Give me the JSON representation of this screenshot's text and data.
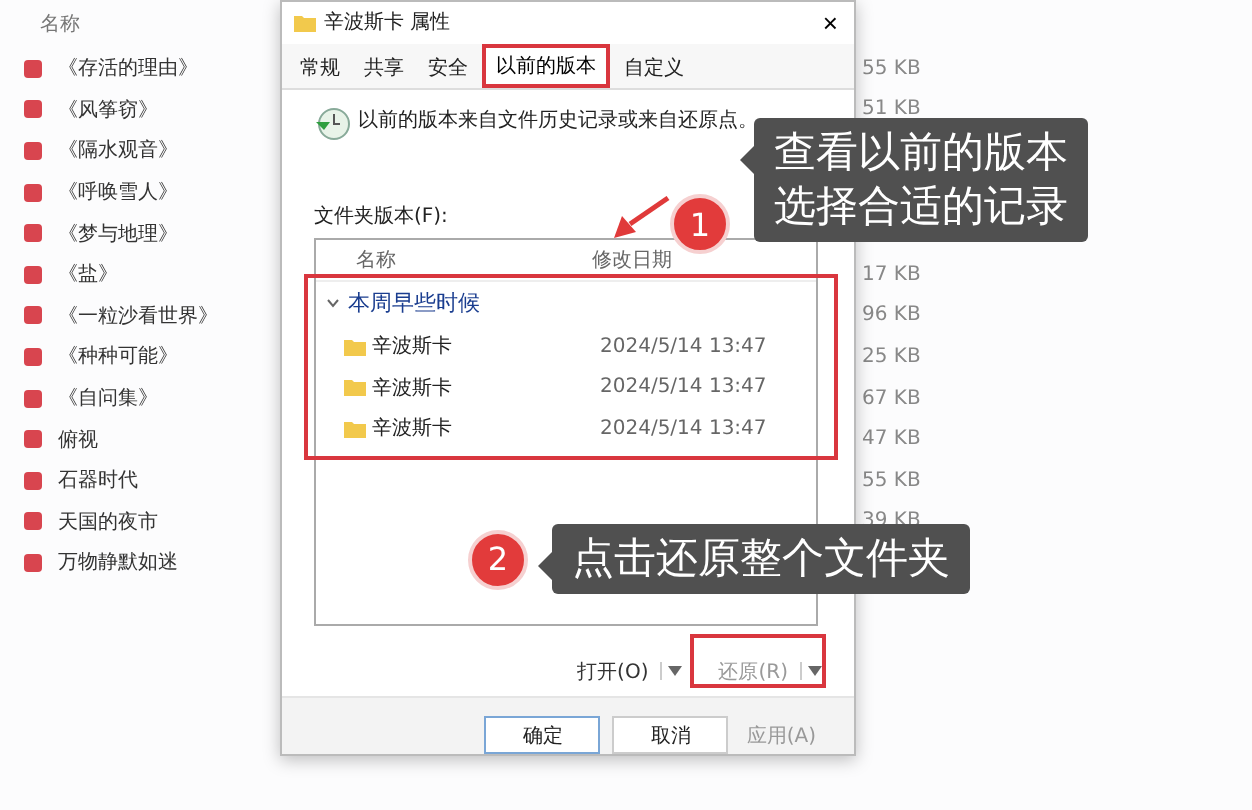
{
  "explorer": {
    "column": "名称",
    "files": [
      {
        "name": "《存活的理由》",
        "size": "55 KB"
      },
      {
        "name": "《风筝窃》",
        "size": "51 KB"
      },
      {
        "name": "《隔水观音》"
      },
      {
        "name": "《呼唤雪人》"
      },
      {
        "name": "《梦与地理》"
      },
      {
        "name": "《盐》",
        "size": "17 KB"
      },
      {
        "name": "《一粒沙看世界》",
        "size": "96 KB"
      },
      {
        "name": "《种种可能》",
        "size": "25 KB"
      },
      {
        "name": "《自问集》",
        "size": "67 KB"
      },
      {
        "name": "俯视",
        "size": "47 KB"
      },
      {
        "name": "石器时代",
        "size": "55 KB"
      },
      {
        "name": "天国的夜市",
        "size": "39 KB"
      },
      {
        "name": "万物静默如迷"
      }
    ]
  },
  "dialog": {
    "title": "辛波斯卡 属性",
    "close": "×",
    "tabs": [
      {
        "label": "常规",
        "selected": false,
        "highlighted": false
      },
      {
        "label": "共享",
        "selected": false,
        "highlighted": false
      },
      {
        "label": "安全",
        "selected": false,
        "highlighted": false
      },
      {
        "label": "以前的版本",
        "selected": true,
        "highlighted": true
      },
      {
        "label": "自定义",
        "selected": false,
        "highlighted": false
      }
    ],
    "info": "以前的版本来自文件历史记录或来自还原点。",
    "versions_label": "文件夹版本(F):",
    "columns": [
      "名称",
      "修改日期"
    ],
    "groups": [
      {
        "label": "本周早些时候",
        "expanded": true,
        "rows": [
          {
            "name": "辛波斯卡",
            "date": "2024/5/14 13:47"
          },
          {
            "name": "辛波斯卡",
            "date": "2024/5/14 13:47"
          },
          {
            "name": "辛波斯卡",
            "date": "2024/5/14 13:47"
          }
        ]
      }
    ],
    "actions": [
      {
        "label": "打开(O)",
        "disabled": false
      },
      {
        "label": "还原(R)",
        "disabled": true
      }
    ],
    "buttons": [
      {
        "label": "确定",
        "disabled": false
      },
      {
        "label": "取消",
        "disabled": false
      },
      {
        "label": "应用(A)",
        "disabled": true
      }
    ]
  },
  "callouts": [
    {
      "number": "1",
      "lines": [
        "查看以前的版本",
        "选择合适的记录"
      ]
    },
    {
      "number": "2",
      "lines": [
        "点击还原整个文件夹"
      ]
    }
  ]
}
